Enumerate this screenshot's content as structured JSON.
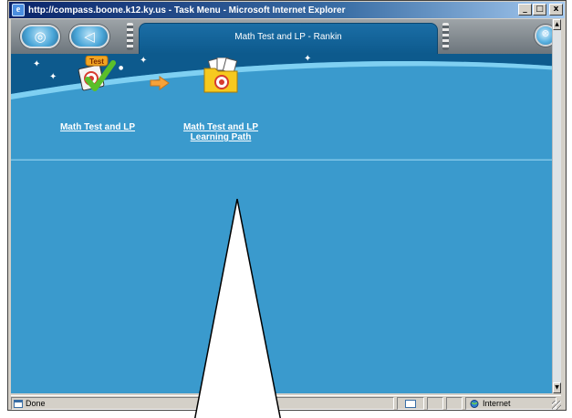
{
  "window": {
    "title": "http://compass.boone.k12.ky.us - Task Menu - Microsoft Internet Explorer",
    "buttons": {
      "minimize": "_",
      "maximize": "□",
      "close": "x"
    }
  },
  "header": {
    "page_title": "Math Test and LP - Rankin"
  },
  "tasks": [
    {
      "label": "Math Test and LP",
      "icon": "test-checkmark-icon"
    },
    {
      "label_line1": "Math Test and LP",
      "label_line2": "Learning Path",
      "icon": "learning-path-folder-icon"
    }
  ],
  "statusbar": {
    "status": "Done",
    "zone": "Internet"
  },
  "colors": {
    "content_bg": "#3a9acd",
    "header_tab": "#0d5a8d",
    "toolbar": "#8a9196"
  }
}
